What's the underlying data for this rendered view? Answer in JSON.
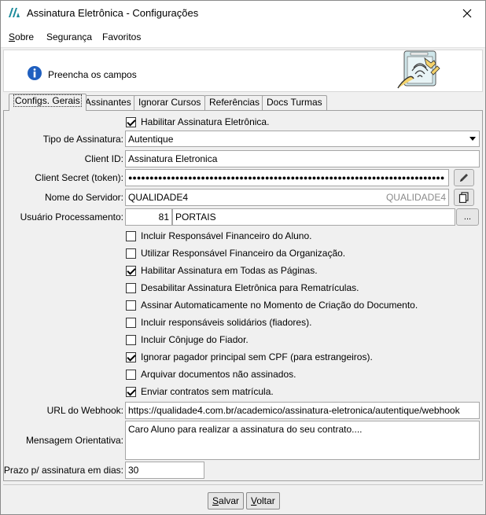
{
  "window": {
    "title": "Assinatura Eletrônica - Configurações"
  },
  "menu": {
    "sobre_u": "S",
    "sobre_rest": "obre",
    "seguranca": "Segurança",
    "favoritos": "Favoritos"
  },
  "header": {
    "text": "Preencha os campos"
  },
  "tabs": [
    {
      "label": "Configs. Gerais"
    },
    {
      "label": "Assinantes"
    },
    {
      "label": "Ignorar Cursos"
    },
    {
      "label": "Referências"
    },
    {
      "label": "Docs Turmas"
    }
  ],
  "form": {
    "habilitar_label": "Habilitar Assinatura Eletrônica.",
    "tipo_label": "Tipo de Assinatura:",
    "tipo_value": "Autentique",
    "client_id_label": "Client ID:",
    "client_id_value": "Assinatura Eletronica",
    "client_secret_label": "Client Secret (token):",
    "client_secret_value": "●●●●●●●●●●●●●●●●●●●●●●●●●●●●●●●●●●●●●●●●●●●●●●●●●●●●●●●●●●●●●●●●●●●●●●●●●●",
    "servidor_label": "Nome do Servidor:",
    "servidor_value": "QUALIDADE4",
    "servidor_hint": "QUALIDADE4",
    "usuario_label": "Usuário Processamento:",
    "usuario_code": "81",
    "usuario_name": "PORTAIS",
    "usuario_btn": "...",
    "webhook_label": "URL do Webhook:",
    "webhook_value": "https://qualidade4.com.br/academico/assinatura-eletronica/autentique/webhook",
    "mensagem_label": "Mensagem Orientativa:",
    "mensagem_value": "Caro Aluno para realizar a assinatura do seu contrato....",
    "prazo_label": "Prazo p/ assinatura em dias:",
    "prazo_value": "30"
  },
  "checkboxes": [
    {
      "label": "Incluir Responsável Financeiro do Aluno.",
      "checked": false
    },
    {
      "label": "Utilizar Responsável Financeiro da Organização.",
      "checked": false
    },
    {
      "label": "Habilitar Assinatura em Todas as Páginas.",
      "checked": true
    },
    {
      "label": "Desabilitar Assinatura Eletrônica para Rematrículas.",
      "checked": false
    },
    {
      "label": "Assinar Automaticamente no Momento de Criação do Documento.",
      "checked": false
    },
    {
      "label": "Incluir responsáveis solidários (fiadores).",
      "checked": false
    },
    {
      "label": "Incluir Cônjuge do Fiador.",
      "checked": false
    },
    {
      "label": "Ignorar pagador principal sem CPF (para estrangeiros).",
      "checked": true
    },
    {
      "label": "Arquivar documentos não assinados.",
      "checked": false
    },
    {
      "label": "Enviar contratos sem matrícula.",
      "checked": true
    }
  ],
  "footer": {
    "salvar_u": "S",
    "salvar_rest": "alvar",
    "voltar_u": "V",
    "voltar_rest": "oltar"
  },
  "colors": {
    "info_icon": "#1f5fbf",
    "accent_teal": "#1a8a9a"
  }
}
